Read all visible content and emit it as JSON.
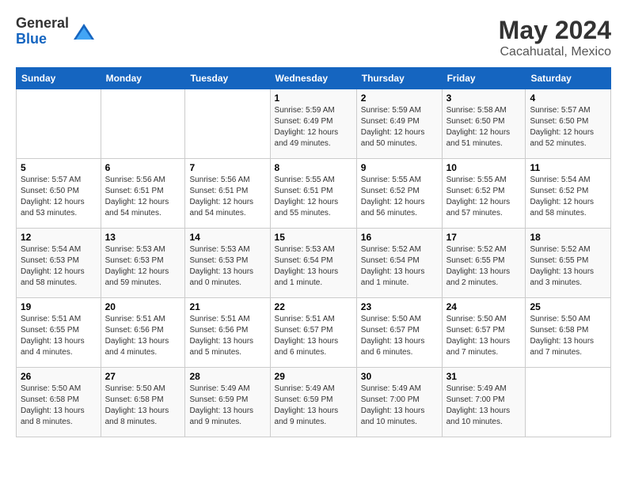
{
  "logo": {
    "general": "General",
    "blue": "Blue"
  },
  "title": {
    "month_year": "May 2024",
    "location": "Cacahuatal, Mexico"
  },
  "header_days": [
    "Sunday",
    "Monday",
    "Tuesday",
    "Wednesday",
    "Thursday",
    "Friday",
    "Saturday"
  ],
  "weeks": [
    {
      "days": [
        {
          "num": "",
          "info": ""
        },
        {
          "num": "",
          "info": ""
        },
        {
          "num": "",
          "info": ""
        },
        {
          "num": "1",
          "info": "Sunrise: 5:59 AM\nSunset: 6:49 PM\nDaylight: 12 hours\nand 49 minutes."
        },
        {
          "num": "2",
          "info": "Sunrise: 5:59 AM\nSunset: 6:49 PM\nDaylight: 12 hours\nand 50 minutes."
        },
        {
          "num": "3",
          "info": "Sunrise: 5:58 AM\nSunset: 6:50 PM\nDaylight: 12 hours\nand 51 minutes."
        },
        {
          "num": "4",
          "info": "Sunrise: 5:57 AM\nSunset: 6:50 PM\nDaylight: 12 hours\nand 52 minutes."
        }
      ]
    },
    {
      "days": [
        {
          "num": "5",
          "info": "Sunrise: 5:57 AM\nSunset: 6:50 PM\nDaylight: 12 hours\nand 53 minutes."
        },
        {
          "num": "6",
          "info": "Sunrise: 5:56 AM\nSunset: 6:51 PM\nDaylight: 12 hours\nand 54 minutes."
        },
        {
          "num": "7",
          "info": "Sunrise: 5:56 AM\nSunset: 6:51 PM\nDaylight: 12 hours\nand 54 minutes."
        },
        {
          "num": "8",
          "info": "Sunrise: 5:55 AM\nSunset: 6:51 PM\nDaylight: 12 hours\nand 55 minutes."
        },
        {
          "num": "9",
          "info": "Sunrise: 5:55 AM\nSunset: 6:52 PM\nDaylight: 12 hours\nand 56 minutes."
        },
        {
          "num": "10",
          "info": "Sunrise: 5:55 AM\nSunset: 6:52 PM\nDaylight: 12 hours\nand 57 minutes."
        },
        {
          "num": "11",
          "info": "Sunrise: 5:54 AM\nSunset: 6:52 PM\nDaylight: 12 hours\nand 58 minutes."
        }
      ]
    },
    {
      "days": [
        {
          "num": "12",
          "info": "Sunrise: 5:54 AM\nSunset: 6:53 PM\nDaylight: 12 hours\nand 58 minutes."
        },
        {
          "num": "13",
          "info": "Sunrise: 5:53 AM\nSunset: 6:53 PM\nDaylight: 12 hours\nand 59 minutes."
        },
        {
          "num": "14",
          "info": "Sunrise: 5:53 AM\nSunset: 6:53 PM\nDaylight: 13 hours\nand 0 minutes."
        },
        {
          "num": "15",
          "info": "Sunrise: 5:53 AM\nSunset: 6:54 PM\nDaylight: 13 hours\nand 1 minute."
        },
        {
          "num": "16",
          "info": "Sunrise: 5:52 AM\nSunset: 6:54 PM\nDaylight: 13 hours\nand 1 minute."
        },
        {
          "num": "17",
          "info": "Sunrise: 5:52 AM\nSunset: 6:55 PM\nDaylight: 13 hours\nand 2 minutes."
        },
        {
          "num": "18",
          "info": "Sunrise: 5:52 AM\nSunset: 6:55 PM\nDaylight: 13 hours\nand 3 minutes."
        }
      ]
    },
    {
      "days": [
        {
          "num": "19",
          "info": "Sunrise: 5:51 AM\nSunset: 6:55 PM\nDaylight: 13 hours\nand 4 minutes."
        },
        {
          "num": "20",
          "info": "Sunrise: 5:51 AM\nSunset: 6:56 PM\nDaylight: 13 hours\nand 4 minutes."
        },
        {
          "num": "21",
          "info": "Sunrise: 5:51 AM\nSunset: 6:56 PM\nDaylight: 13 hours\nand 5 minutes."
        },
        {
          "num": "22",
          "info": "Sunrise: 5:51 AM\nSunset: 6:57 PM\nDaylight: 13 hours\nand 6 minutes."
        },
        {
          "num": "23",
          "info": "Sunrise: 5:50 AM\nSunset: 6:57 PM\nDaylight: 13 hours\nand 6 minutes."
        },
        {
          "num": "24",
          "info": "Sunrise: 5:50 AM\nSunset: 6:57 PM\nDaylight: 13 hours\nand 7 minutes."
        },
        {
          "num": "25",
          "info": "Sunrise: 5:50 AM\nSunset: 6:58 PM\nDaylight: 13 hours\nand 7 minutes."
        }
      ]
    },
    {
      "days": [
        {
          "num": "26",
          "info": "Sunrise: 5:50 AM\nSunset: 6:58 PM\nDaylight: 13 hours\nand 8 minutes."
        },
        {
          "num": "27",
          "info": "Sunrise: 5:50 AM\nSunset: 6:58 PM\nDaylight: 13 hours\nand 8 minutes."
        },
        {
          "num": "28",
          "info": "Sunrise: 5:49 AM\nSunset: 6:59 PM\nDaylight: 13 hours\nand 9 minutes."
        },
        {
          "num": "29",
          "info": "Sunrise: 5:49 AM\nSunset: 6:59 PM\nDaylight: 13 hours\nand 9 minutes."
        },
        {
          "num": "30",
          "info": "Sunrise: 5:49 AM\nSunset: 7:00 PM\nDaylight: 13 hours\nand 10 minutes."
        },
        {
          "num": "31",
          "info": "Sunrise: 5:49 AM\nSunset: 7:00 PM\nDaylight: 13 hours\nand 10 minutes."
        },
        {
          "num": "",
          "info": ""
        }
      ]
    }
  ]
}
